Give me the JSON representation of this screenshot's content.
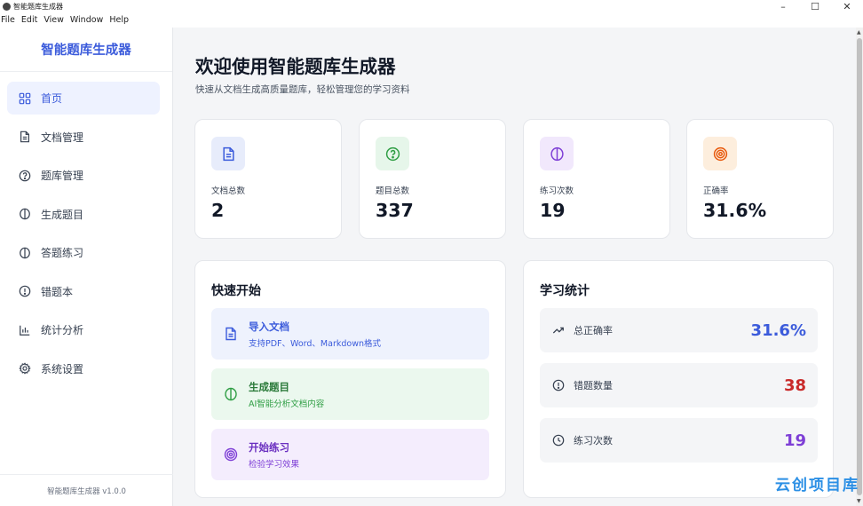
{
  "window": {
    "title": "智能题库生成器",
    "controls": {
      "minimize": "–",
      "maximize": "☐",
      "close": "✕"
    }
  },
  "menu": [
    "File",
    "Edit",
    "View",
    "Window",
    "Help"
  ],
  "sidebar": {
    "brand": "智能题库生成器",
    "items": [
      {
        "label": "首页",
        "icon": "dashboard-grid-icon",
        "active": true
      },
      {
        "label": "文档管理",
        "icon": "document-icon",
        "active": false
      },
      {
        "label": "题库管理",
        "icon": "question-circle-icon",
        "active": false
      },
      {
        "label": "生成题目",
        "icon": "brain-icon",
        "active": false
      },
      {
        "label": "答题练习",
        "icon": "brain-icon",
        "active": false
      },
      {
        "label": "错题本",
        "icon": "alert-circle-icon",
        "active": false
      },
      {
        "label": "统计分析",
        "icon": "bar-chart-icon",
        "active": false
      },
      {
        "label": "系统设置",
        "icon": "gear-icon",
        "active": false
      }
    ],
    "version": "智能题库生成器 v1.0.0"
  },
  "header": {
    "title": "欢迎使用智能题库生成器",
    "subtitle": "快速从文档生成高质量题库，轻松管理您的学习资料"
  },
  "stats": [
    {
      "label": "文档总数",
      "value": "2",
      "icon": "document-icon",
      "color": "#3b5bdb",
      "bg": "#e7ecfb"
    },
    {
      "label": "题目总数",
      "value": "337",
      "icon": "question-circle-icon",
      "color": "#2f9e44",
      "bg": "#e6f6ea"
    },
    {
      "label": "练习次数",
      "value": "19",
      "icon": "brain-icon",
      "color": "#7e3fd6",
      "bg": "#f1e8fc"
    },
    {
      "label": "正确率",
      "value": "31.6%",
      "icon": "target-icon",
      "color": "#e8590c",
      "bg": "#fdeedd"
    }
  ],
  "quick_start": {
    "title": "快速开始",
    "items": [
      {
        "title": "导入文档",
        "desc": "支持PDF、Word、Markdown格式",
        "icon": "document-icon",
        "color": "#3b5bdb",
        "bg": "#eef2fd"
      },
      {
        "title": "生成题目",
        "desc": "AI智能分析文档内容",
        "icon": "brain-icon",
        "color": "#2f9e44",
        "bg": "#ebf8ee"
      },
      {
        "title": "开始练习",
        "desc": "检验学习效果",
        "icon": "target-icon",
        "color": "#7e3fd6",
        "bg": "#f4edfd"
      }
    ]
  },
  "learning_stats": {
    "title": "学习统计",
    "rows": [
      {
        "label": "总正确率",
        "value": "31.6%",
        "icon": "trending-up-icon",
        "color": "#3b5bdb"
      },
      {
        "label": "错题数量",
        "value": "38",
        "icon": "alert-circle-icon",
        "color": "#c92a2a"
      },
      {
        "label": "练习次数",
        "value": "19",
        "icon": "clock-icon",
        "color": "#7e3fd6"
      }
    ]
  },
  "watermark": "云创项目库"
}
